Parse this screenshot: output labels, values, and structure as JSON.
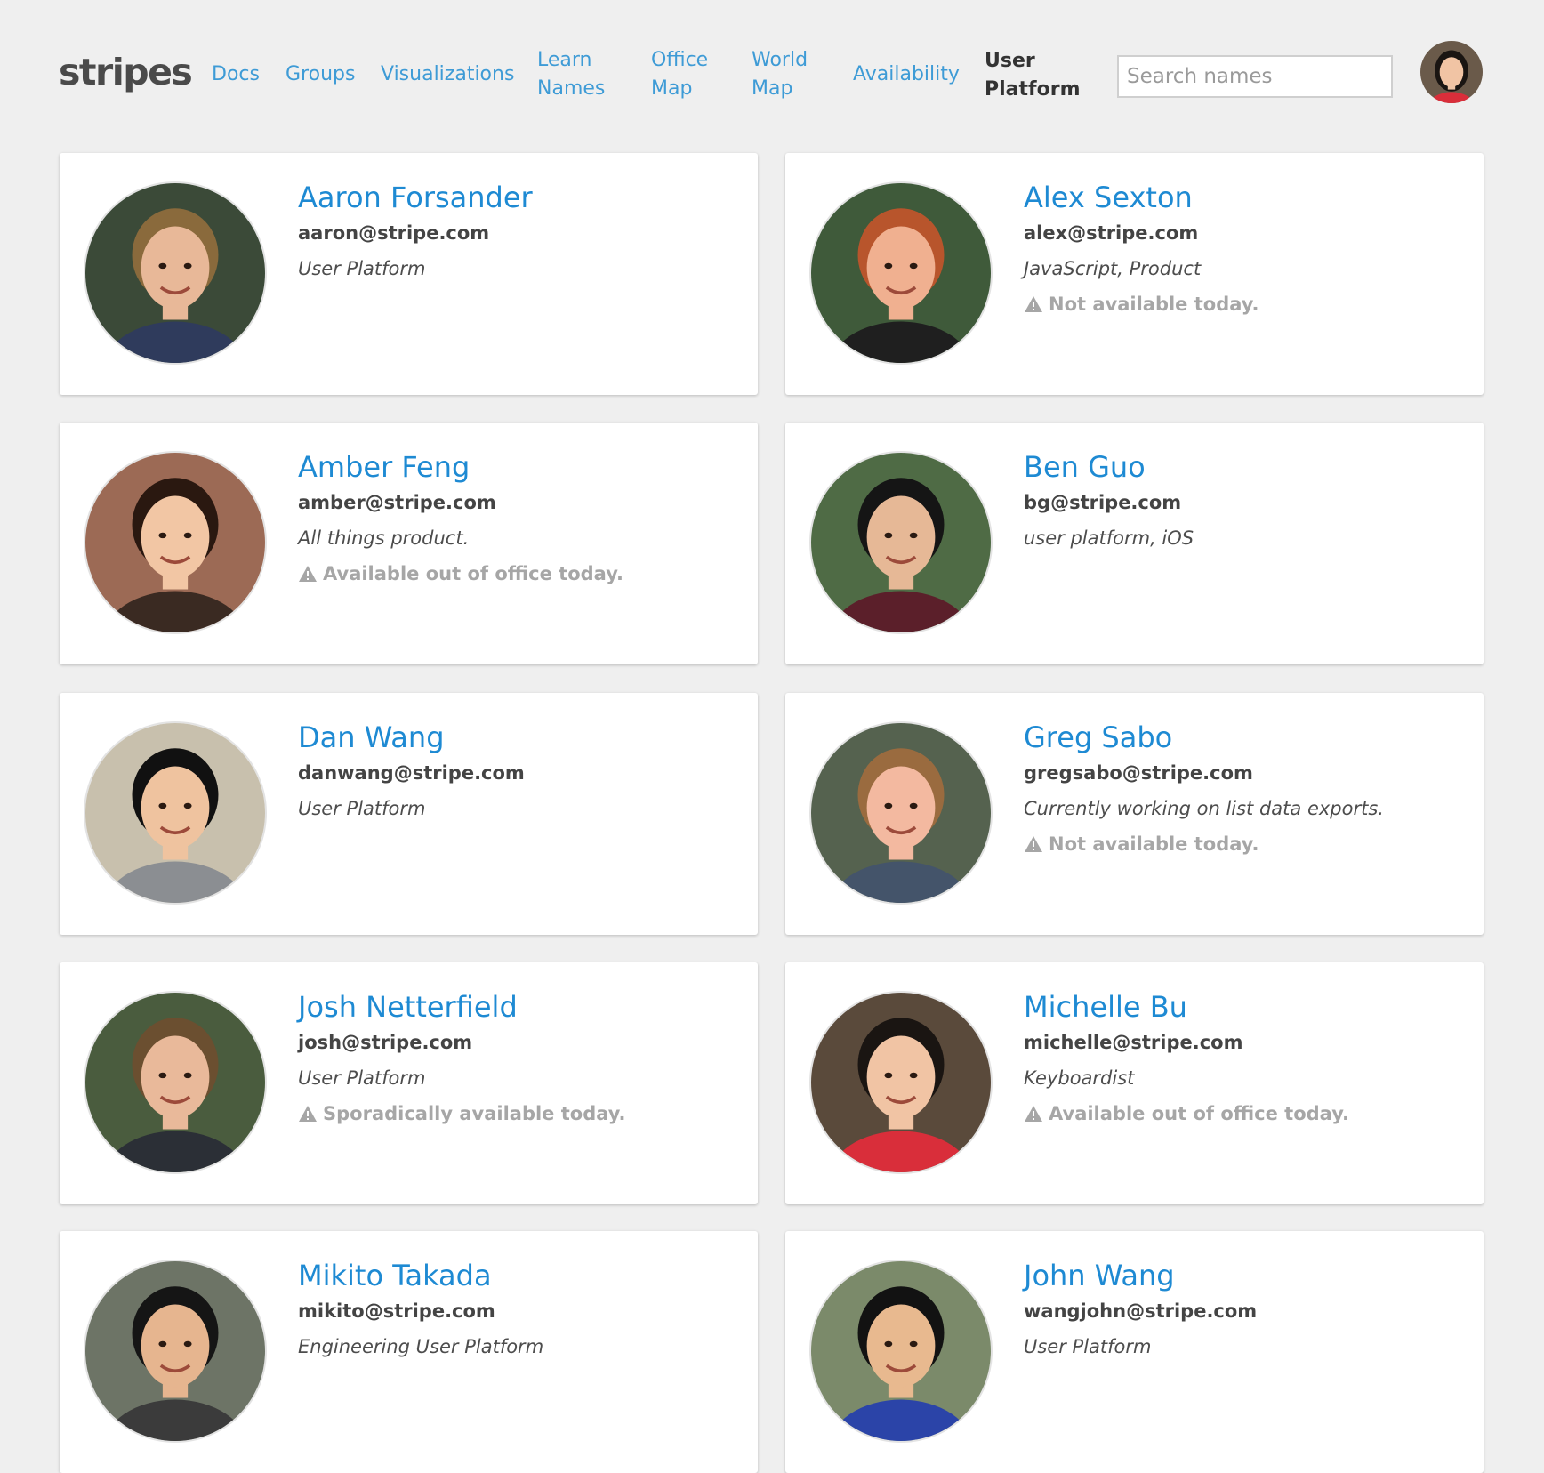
{
  "header": {
    "logo": "stripes",
    "nav": [
      {
        "label": "Docs"
      },
      {
        "label": "Groups"
      },
      {
        "label": "Visualizations"
      },
      {
        "label": "Learn Names"
      },
      {
        "label": "Office Map"
      },
      {
        "label": "World Map"
      },
      {
        "label": "Availability"
      },
      {
        "label": "User Platform"
      }
    ],
    "search_placeholder": "Search names",
    "search_value": "",
    "user_avatar_icon": "user-avatar-photo"
  },
  "people": [
    {
      "name": "Aaron Forsander",
      "email": "aaron@stripe.com",
      "team": "User Platform",
      "status": "",
      "photo": {
        "bg": "#3b4a38",
        "skin": "#e8b898",
        "hair": "#8a6a3c",
        "shirt": "#2f3b5c"
      }
    },
    {
      "name": "Alex Sexton",
      "email": "alex@stripe.com",
      "team": "JavaScript, Product",
      "status": "Not available today.",
      "photo": {
        "bg": "#3f5a3a",
        "skin": "#f0b090",
        "hair": "#b8552c",
        "shirt": "#1f1f1f"
      }
    },
    {
      "name": "Amber Feng",
      "email": "amber@stripe.com",
      "team": "All things product.",
      "status": "Available out of office today.",
      "photo": {
        "bg": "#9c6a55",
        "skin": "#f2c6a4",
        "hair": "#2a1810",
        "shirt": "#3a2a22"
      }
    },
    {
      "name": "Ben Guo",
      "email": "bg@stripe.com",
      "team": "user platform, iOS",
      "status": "",
      "photo": {
        "bg": "#4f6b45",
        "skin": "#e6b896",
        "hair": "#151515",
        "shirt": "#5b1f2a"
      }
    },
    {
      "name": "Dan Wang",
      "email": "danwang@stripe.com",
      "team": "User Platform",
      "status": "",
      "photo": {
        "bg": "#c8c0ad",
        "skin": "#efc39f",
        "hair": "#111111",
        "shirt": "#8b8e92"
      }
    },
    {
      "name": "Greg Sabo",
      "email": "gregsabo@stripe.com",
      "team": "Currently working on list data exports.",
      "status": "Not available today.",
      "photo": {
        "bg": "#55624f",
        "skin": "#f3b9a0",
        "hair": "#9a6b3f",
        "shirt": "#44546a"
      }
    },
    {
      "name": "Josh Netterfield",
      "email": "josh@stripe.com",
      "team": "User Platform",
      "status": "Sporadically available today.",
      "photo": {
        "bg": "#4a5c3e",
        "skin": "#e9b99a",
        "hair": "#6b4f30",
        "shirt": "#2b2f36"
      }
    },
    {
      "name": "Michelle Bu",
      "email": "michelle@stripe.com",
      "team": "Keyboardist",
      "status": "Available out of office today.",
      "photo": {
        "bg": "#5a4a3b",
        "skin": "#f1c4a4",
        "hair": "#1a1512",
        "shirt": "#d92e3a"
      }
    },
    {
      "name": "Mikito Takada",
      "email": "mikito@stripe.com",
      "team": "Engineering User Platform",
      "status": "",
      "photo": {
        "bg": "#6d7466",
        "skin": "#e6b58f",
        "hair": "#151515",
        "shirt": "#3b3b3b"
      }
    },
    {
      "name": "John Wang",
      "email": "wangjohn@stripe.com",
      "team": "User Platform",
      "status": "",
      "photo": {
        "bg": "#7b8a6a",
        "skin": "#e8b98f",
        "hair": "#121212",
        "shirt": "#2b44a8"
      }
    }
  ],
  "colors": {
    "background": "#efefef",
    "link": "#1e8ad3",
    "nav_link": "#3e9bd6",
    "muted": "#a6a6a6"
  }
}
